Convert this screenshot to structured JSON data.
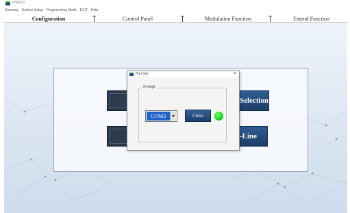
{
  "window": {
    "title": "PS6000",
    "icon": "app-icon"
  },
  "menu": {
    "items": [
      "Gateway",
      "System Setup",
      "Programming Mode",
      "EXIT",
      "Help"
    ]
  },
  "tabs": [
    {
      "label": "Configuration",
      "active": true
    },
    {
      "label": "Control Panel",
      "active": false
    },
    {
      "label": "Modulation Function",
      "active": false
    },
    {
      "label": "Extend Function",
      "active": false
    }
  ],
  "main": {
    "right_buttons": [
      {
        "label": "Selection"
      },
      {
        "label": "-Line"
      }
    ]
  },
  "dialog": {
    "title": "Port Set",
    "close_glyph": "×",
    "group_label": "Prompt",
    "port": {
      "selected": "COM3"
    },
    "close_button_label": "Close",
    "status_color": "#16d41c"
  },
  "colors": {
    "button_dark": "#2b3a4e",
    "button_blue": "#1d3d68",
    "selection_blue": "#1d62c7",
    "status_green": "#16d41c"
  }
}
